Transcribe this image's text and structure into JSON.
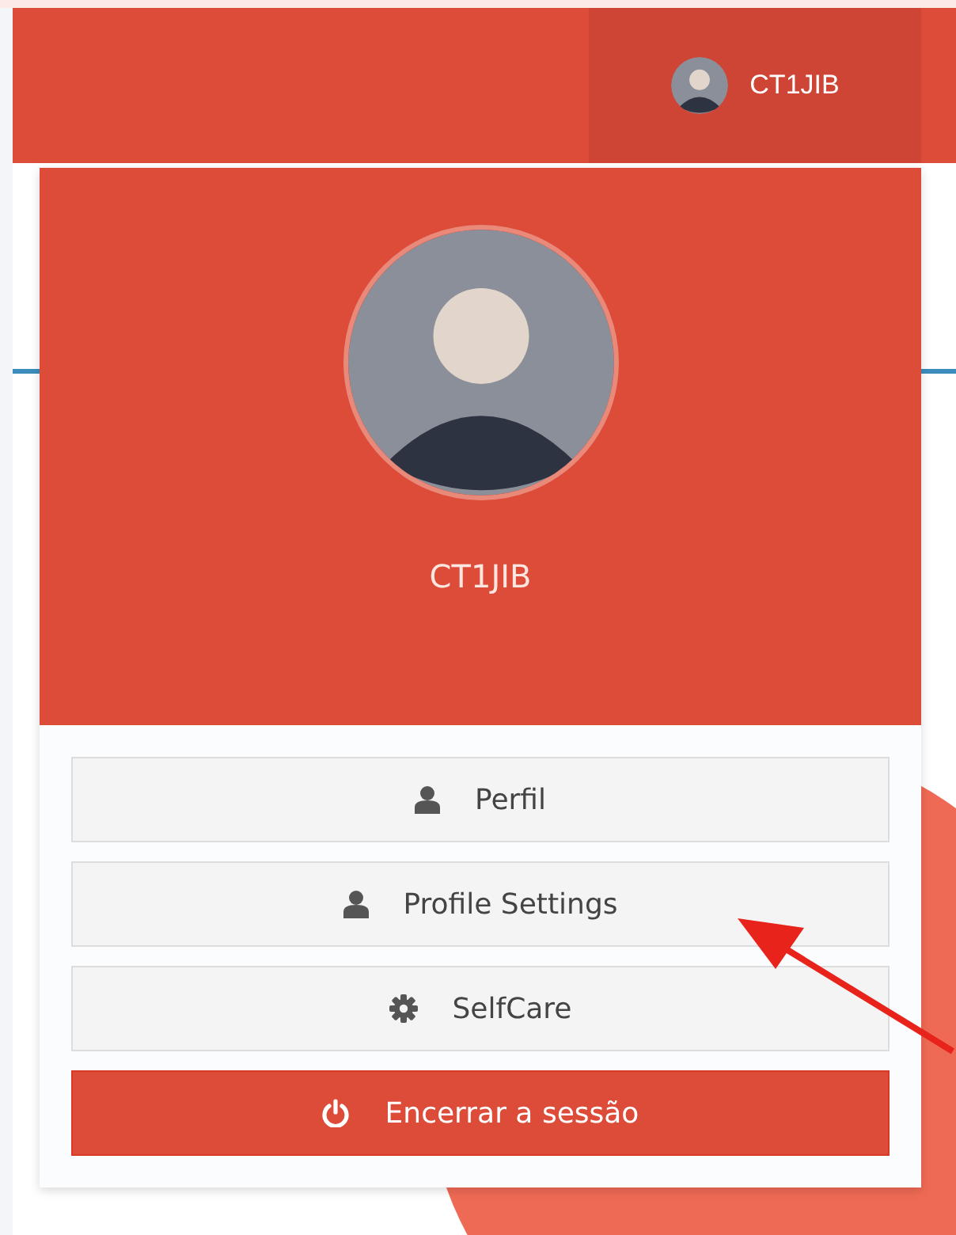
{
  "navbar": {
    "user": {
      "name": "CT1JIB"
    }
  },
  "user_menu": {
    "name": "CT1JIB",
    "items": [
      {
        "label": "Perfil",
        "kind": "user"
      },
      {
        "label": "Profile Settings",
        "kind": "user"
      },
      {
        "label": "SelfCare",
        "kind": "gear"
      },
      {
        "label": "Encerrar a sessão",
        "kind": "power"
      }
    ]
  }
}
